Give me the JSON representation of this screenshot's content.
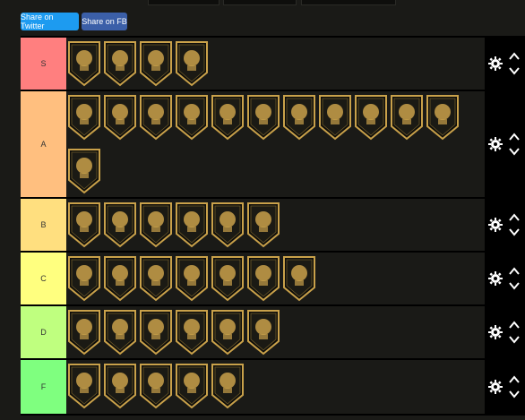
{
  "header": {
    "share_twitter_label": "Share on Twitter",
    "share_fb_label": "Share on FB"
  },
  "colors": {
    "tier_s": "#ff7f7f",
    "tier_a": "#ffbf7f",
    "tier_b": "#ffdf7f",
    "tier_c": "#ffff7f",
    "tier_d": "#bfff7f",
    "tier_f": "#7fff7f",
    "badge_gold": "#c9a14a",
    "row_background": "#1a1a17"
  },
  "tiers": [
    {
      "label": "S",
      "badges": [
        "basketball-hoop-icon",
        "brick-wall-icon",
        "rising-player-icon",
        "lifter-icon"
      ]
    },
    {
      "label": "A",
      "badges": [
        "raised-fist-icon",
        "treasure-box-icon",
        "chess-pawn-icon",
        "fighter-jet-icon",
        "knight-piece-icon",
        "skull-target-icon",
        "hammer-icon",
        "flaming-ball-icon",
        "coin-icon",
        "calendar-one-icon",
        "hand-icon",
        "thinking-head-icon"
      ]
    },
    {
      "label": "B",
      "badges": [
        "player-icon",
        "wings-icon",
        "stadium-icon",
        "road-icon",
        "pogo-stick-icon",
        "wifi-ball-icon"
      ]
    },
    {
      "label": "C",
      "badges": [
        "slash-icon",
        "player-stance-icon",
        "fist-icon",
        "jumping-player-icon",
        "mosquito-icon",
        "basket-icon",
        "money-bag-icon"
      ]
    },
    {
      "label": "D",
      "badges": [
        "dunk-player-icon",
        "checkered-flag-icon",
        "gavel-icon",
        "padlock-icon",
        "leaf-icon",
        "chain-link-icon"
      ]
    },
    {
      "label": "F",
      "badges": [
        "shooter-icon",
        "volleyball-icon",
        "shield-icon",
        "bodybuilder-icon",
        "masked-figure-icon"
      ]
    }
  ]
}
